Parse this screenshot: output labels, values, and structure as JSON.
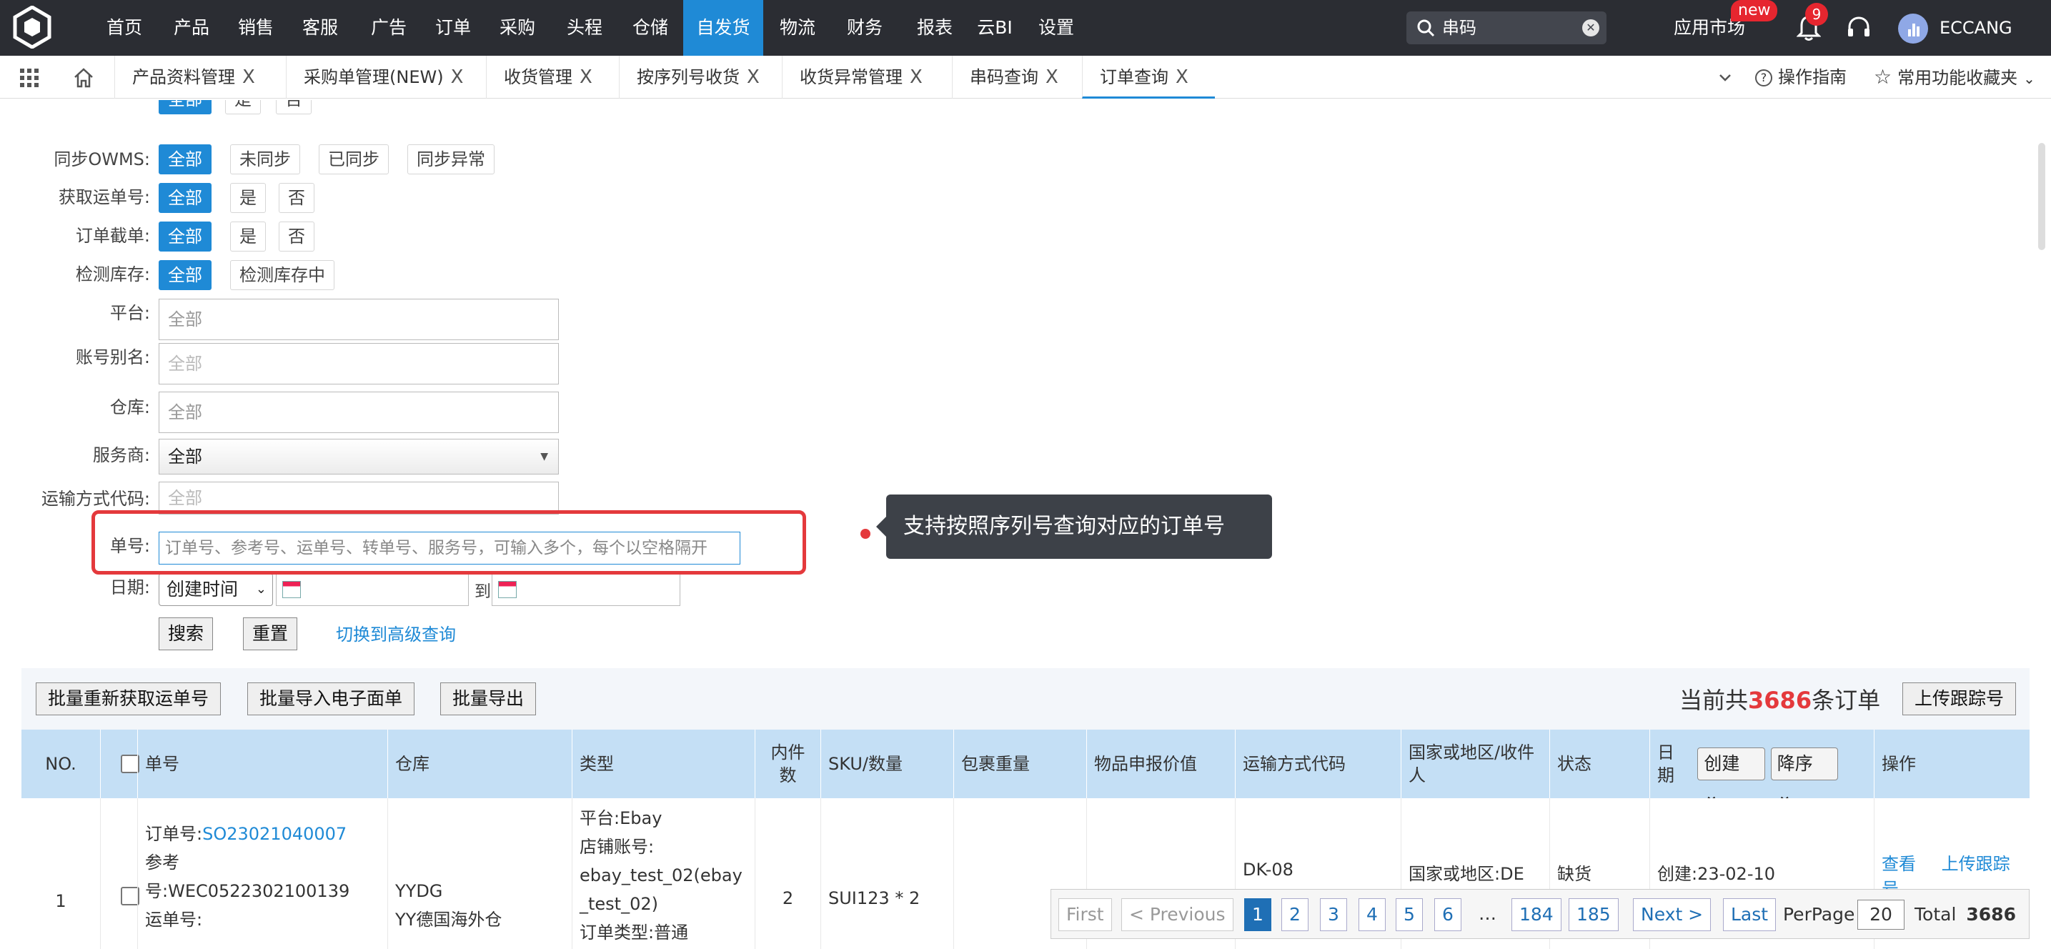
{
  "topnav": {
    "items": [
      "首页",
      "产品",
      "销售",
      "客服",
      "广告",
      "订单",
      "采购",
      "头程",
      "仓储",
      "自发货",
      "物流",
      "财务",
      "报表",
      "云BI",
      "设置"
    ],
    "active_index": 9,
    "search_value": "串码",
    "app_market": "应用市场",
    "new_badge": "new",
    "notification_count": "9",
    "user_name": "ECCANG"
  },
  "tabs": {
    "items": [
      "产品资料管理",
      "采购单管理(NEW)",
      "收货管理",
      "按序列号收货",
      "收货异常管理",
      "串码查询",
      "订单查询"
    ],
    "close_glyph": "X",
    "active_index": 6,
    "guide": "操作指南",
    "favorites": "常用功能收藏夹"
  },
  "filters": {
    "partial_chip_yes": "是",
    "partial_chip_no": "否",
    "partial_chip_all": "全部",
    "sync_owms": {
      "label": "同步OWMS:",
      "options": [
        "全部",
        "未同步",
        "已同步",
        "同步异常"
      ]
    },
    "get_tracking": {
      "label": "获取运单号:",
      "options": [
        "全部",
        "是",
        "否"
      ]
    },
    "intercept": {
      "label": "订单截单:",
      "options": [
        "全部",
        "是",
        "否"
      ]
    },
    "stock_check": {
      "label": "检测库存:",
      "options": [
        "全部",
        "检测库存中"
      ]
    },
    "platform": {
      "label": "平台:",
      "placeholder": "全部"
    },
    "account": {
      "label": "账号别名:",
      "placeholder": "全部"
    },
    "warehouse": {
      "label": "仓库:",
      "placeholder": "全部"
    },
    "provider": {
      "label": "服务商:",
      "value": "全部"
    },
    "ship_code": {
      "label": "运输方式代码:",
      "placeholder": "全部"
    },
    "order_no": {
      "label": "单号:",
      "placeholder": "订单号、参考号、运单号、转单号、服务号，可输入多个，每个以空格隔开"
    },
    "date": {
      "label": "日期:",
      "type": "创建时间",
      "to": "到"
    },
    "search_btn": "搜索",
    "reset_btn": "重置",
    "advanced_link": "切换到高级查询"
  },
  "tooltip": "支持按照序列号查询对应的订单号",
  "actions": {
    "refetch": "批量重新获取运单号",
    "import": "批量导入电子面单",
    "export": "批量导出",
    "total_prefix": "当前共",
    "total_count": "3686",
    "total_suffix": "条订单",
    "upload": "上传跟踪号"
  },
  "table": {
    "headers": [
      "NO.",
      "单号",
      "仓库",
      "类型",
      "内件数",
      "SKU/数量",
      "包裹重量",
      "物品申报价值",
      "运输方式代码",
      "国家或地区/收件人",
      "状态",
      "日期",
      "操作"
    ],
    "date_sort_field": "创建",
    "date_sort_order": "降序",
    "row": {
      "no": "1",
      "order_label": "订单号:",
      "order_no": "SO23021040007",
      "ref_label": "参考",
      "ref_value": "号:WEC0522302100139",
      "tracking_label": "运单号:",
      "warehouse_code": "YYDG",
      "warehouse_name": "YY德国海外仓",
      "platform": "平台:Ebay",
      "store_label": "店铺账号:",
      "store_value": "ebay_test_02(ebay_test_02)",
      "order_type": "订单类型:普通",
      "item_count": "2",
      "sku_qty": "SUI123 * 2",
      "ship_code": "DK-08",
      "country": "国家或地区:DE",
      "status": "缺货",
      "date": "创建:23-02-10",
      "view": "查看",
      "upload": "上传跟踪号"
    }
  },
  "pagination": {
    "first": "First",
    "prev": "< Previous",
    "pages": [
      "1",
      "2",
      "3",
      "4",
      "5",
      "6",
      "…",
      "184",
      "185"
    ],
    "current": "1",
    "next": "Next >",
    "last": "Last",
    "per_page_label": "PerPage",
    "per_page": "20",
    "total_label": "Total",
    "total": "3686"
  }
}
